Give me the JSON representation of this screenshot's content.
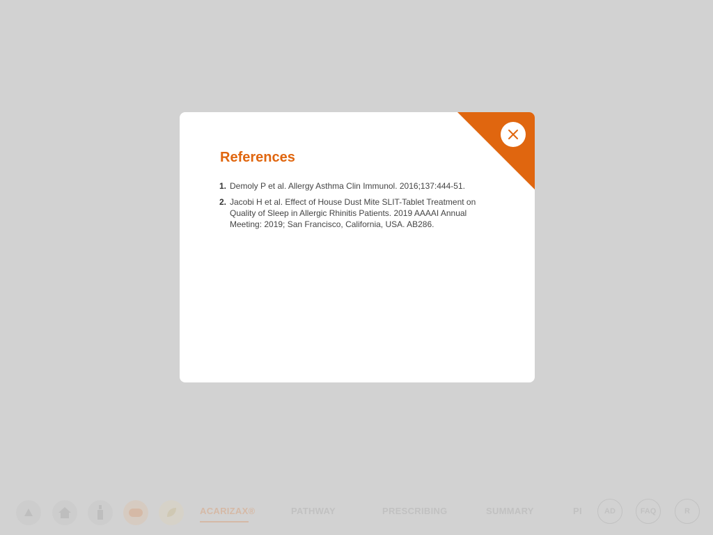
{
  "colors": {
    "accent": "#e0660f",
    "overlay": "#d2d2d2",
    "modal_bg": "#ffffff",
    "text": "#444444"
  },
  "modal": {
    "title": "References",
    "close_icon": "close-icon",
    "references": [
      {
        "number": "1.",
        "text": "Demoly P et al. Allergy Asthma Clin Immunol. 2016;137:444-51."
      },
      {
        "number": "2.",
        "text": "Jacobi H et al. Effect of House Dust Mite SLIT-Tablet Treatment on Quality of Sleep in Allergic Rhinitis Patients. 2019 AAAAI Annual Meeting: 2019; San Francisco, California, USA. AB286."
      }
    ]
  },
  "bottom_nav": {
    "icons": [
      "up-arrow-icon",
      "home-icon",
      "bottle-icon",
      "pill-icon",
      "leaf-icon"
    ],
    "links": {
      "acarizax": "ACARIZAX®",
      "pathway": "PATHWAY",
      "prescribing": "PRESCRIBING",
      "summary": "SUMMARY",
      "pi": "PI"
    },
    "circle_buttons": {
      "ad": "AD",
      "faq": "FAQ",
      "r": "R"
    }
  }
}
